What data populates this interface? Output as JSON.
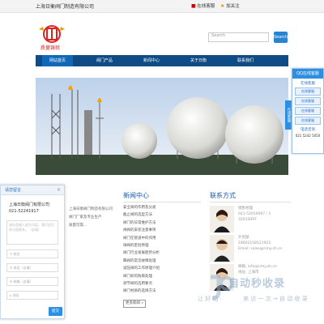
{
  "topbar": {
    "company_name": "上海日衡阀门制造有限公司",
    "online_msg": "在线客服",
    "favorite": "加关注"
  },
  "logo": {
    "text": "质量铸就"
  },
  "search": {
    "placeholder": "Search",
    "button": "Search"
  },
  "nav": {
    "items": [
      "网站首页",
      "阀门产品",
      "新闻中心",
      "关于日衡",
      "联系我们"
    ]
  },
  "side_panel": {
    "title": "QQ在线客服",
    "online_label": "在线客服",
    "qq_items": [
      "在线客服",
      "在线客服",
      "在线客服",
      "在线客服"
    ],
    "phone_label": "电话咨询",
    "phone": "021 5242 5050",
    "tab": "在线客服"
  },
  "sections": {
    "news_title": "新闻中心",
    "contact_title": "联系方式"
  },
  "about": {
    "lines": [
      "上海日衡阀门制造有限公司",
      "阀门厂家及专业生产",
      "质量可靠..."
    ]
  },
  "news": {
    "items": [
      "安全阀的作用及分类",
      "截止阀的选型方法",
      "阀门的日常维护方法",
      "闸阀的安装注意事项",
      "阀门在管道中的作用",
      "球阀的密封原理",
      "阀门行业发展趋势分析",
      "蝶阀的常见故障处理",
      "减压阀的工作原理介绍",
      "阀门如何防腐处理",
      "调节阀的选用要点",
      "阀门材质的选择方法"
    ],
    "more": "更多新闻 »"
  },
  "contact": {
    "rows": [
      {
        "lines": [
          "销售经理",
          "021-52010097 / 1",
          "32010097"
        ]
      },
      {
        "lines": [
          "外贸部",
          "18602158521923",
          "Email: sales@rimy.sh.cn"
        ]
      },
      {
        "lines": [
          "邮箱: info@rimy.sh.cn",
          "地址: 上海市",
          ""
        ]
      }
    ]
  },
  "chat": {
    "title": "请您留言",
    "close": "×",
    "company": "上海日衡阀门有限公司",
    "phone": "021-52241917",
    "textarea_placeholder": "请在此输入留言内容，我们会尽快与您联系。（必填）",
    "name_placeholder": "姓名",
    "phone_placeholder": "电话（必填）",
    "email_placeholder": "邮箱（必填）",
    "address_placeholder": "地址",
    "submit": "提交"
  },
  "watermark": {
    "text": "自动秒收录",
    "sub_left": "让 好 站 ·",
    "sub_right": "来 访 一 次 → 自 动 收 录"
  }
}
